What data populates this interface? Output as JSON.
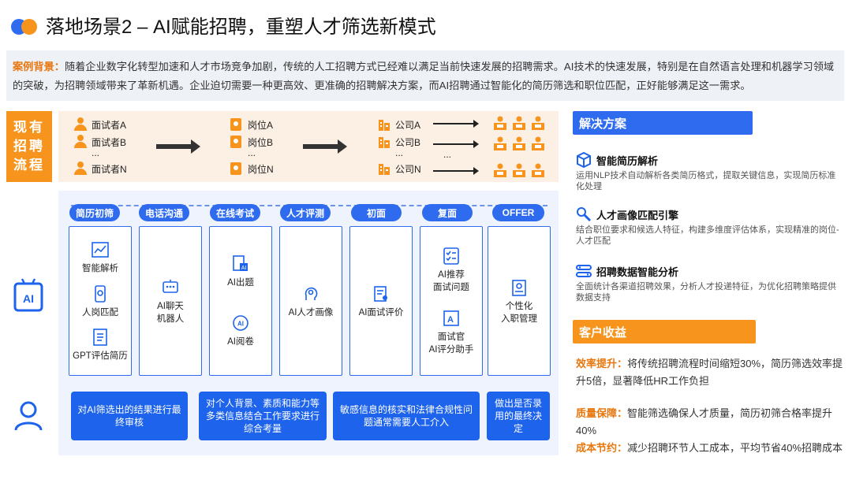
{
  "title": "落地场景2 – AI赋能招聘，重塑人才筛选新模式",
  "background": {
    "label": "案例背景：",
    "text": "随着企业数字化转型加速和人才市场竞争加剧，传统的人工招聘方式已经难以满足当前快速发展的招聘需求。AI技术的快速发展，特别是在自然语言处理和机器学习领域的突破，为招聘领域带来了革新机遇。企业迫切需要一种更高效、更准确的招聘解决方案，而AI招聘通过智能化的简历筛选和职位匹配，正好能够满足这一需求。"
  },
  "existing": {
    "label_lines": [
      "现有",
      "招聘",
      "流程"
    ],
    "interviewers": [
      "面试者A",
      "面试者B",
      "面试者N"
    ],
    "positions": [
      "岗位A",
      "岗位B",
      "岗位N"
    ],
    "companies": [
      "公司A",
      "公司B",
      "公司N"
    ],
    "ellipsis": "..."
  },
  "ai_flow": {
    "steps": [
      "简历初筛",
      "电话沟通",
      "在线考试",
      "人才评测",
      "初面",
      "复面",
      "OFFER"
    ],
    "cards": [
      {
        "features": [
          "智能解析",
          "人岗匹配",
          "GPT评估简历"
        ]
      },
      {
        "features": [
          "AI聊天\n机器人"
        ]
      },
      {
        "features": [
          "AI出题",
          "AI阅卷"
        ]
      },
      {
        "features": [
          "AI人才画像"
        ]
      },
      {
        "features": [
          "AI面试评价"
        ]
      },
      {
        "features": [
          "AI推荐\n面试问题",
          "面试官\nAI评分助手"
        ]
      },
      {
        "features": [
          "个性化\n入职管理"
        ]
      }
    ],
    "human_tasks": [
      "对AI筛选出的结果进行最终审核",
      "对个人背景、素质和能力等多类信息结合工作要求进行综合考量",
      "敏感信息的核实和法律合规性问题通常需要人工介入",
      "做出是否录用的最终决定"
    ]
  },
  "solutions": {
    "title": "解决方案",
    "items": [
      {
        "name": "智能简历解析",
        "desc": "运用NLP技术自动解析各类简历格式，提取关键信息，实现简历标准化处理"
      },
      {
        "name": "人才画像匹配引擎",
        "desc": "结合职位要求和候选人特征，构建多维度评估体系，实现精准的岗位-人才匹配"
      },
      {
        "name": "招聘数据智能分析",
        "desc": "全面统计各渠道招聘效果，分析人才投递特征，为优化招聘策略提供数据支持"
      }
    ]
  },
  "benefits": {
    "title": "客户收益",
    "items": [
      {
        "key": "效率提升：",
        "text": "将传统招聘流程时间缩短30%，简历筛选效率提升5倍，显著降低HR工作负担"
      },
      {
        "key": "质量保障：",
        "text": "智能筛选确保人才质量，简历初筛合格率提升40%"
      },
      {
        "key": "成本节约：",
        "text": "减少招聘环节人工成本，平均节省40%招聘成本"
      }
    ]
  },
  "colors": {
    "blue": "#2e6bef",
    "orange": "#f7941d",
    "dark_blue": "#1d63eb"
  }
}
